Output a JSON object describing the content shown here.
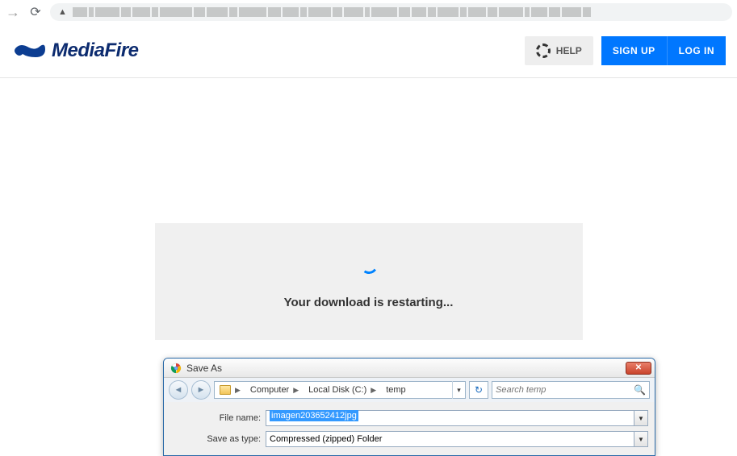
{
  "header": {
    "brand": "MediaFire",
    "help_label": "HELP",
    "signup_label": "SIGN UP",
    "login_label": "LOG IN"
  },
  "main": {
    "download_message": "Your download is restarting..."
  },
  "save_dialog": {
    "title": "Save As",
    "breadcrumb": [
      "Computer",
      "Local Disk (C:)",
      "temp"
    ],
    "search_placeholder": "Search temp",
    "filename_label": "File name:",
    "filename_value": "imagen203652412jpg",
    "savetype_label": "Save as type:",
    "savetype_value": "Compressed (zipped) Folder"
  }
}
